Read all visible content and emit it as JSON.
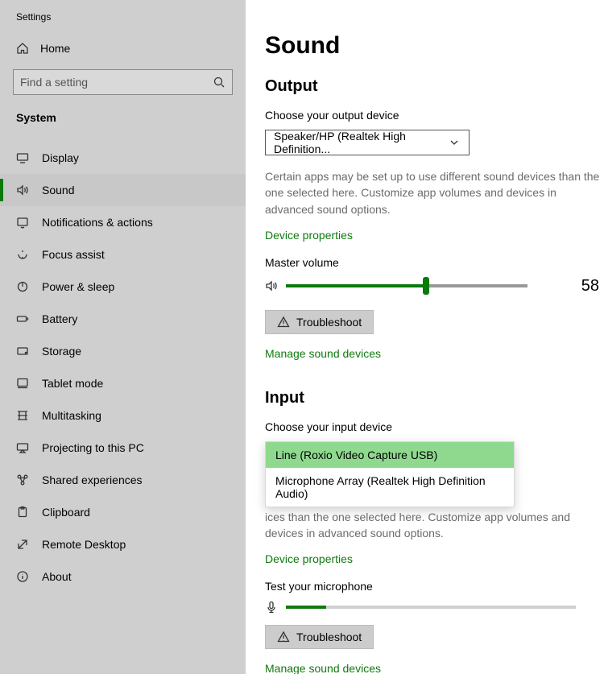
{
  "app_title": "Settings",
  "home_label": "Home",
  "search_placeholder": "Find a setting",
  "section_label": "System",
  "nav": [
    {
      "id": "display",
      "label": "Display"
    },
    {
      "id": "sound",
      "label": "Sound",
      "selected": true
    },
    {
      "id": "notifications",
      "label": "Notifications & actions"
    },
    {
      "id": "focus",
      "label": "Focus assist"
    },
    {
      "id": "power",
      "label": "Power & sleep"
    },
    {
      "id": "battery",
      "label": "Battery"
    },
    {
      "id": "storage",
      "label": "Storage"
    },
    {
      "id": "tablet",
      "label": "Tablet mode"
    },
    {
      "id": "multitask",
      "label": "Multitasking"
    },
    {
      "id": "projecting",
      "label": "Projecting to this PC"
    },
    {
      "id": "shared",
      "label": "Shared experiences"
    },
    {
      "id": "clipboard",
      "label": "Clipboard"
    },
    {
      "id": "remote",
      "label": "Remote Desktop"
    },
    {
      "id": "about",
      "label": "About"
    }
  ],
  "page": {
    "title": "Sound",
    "output": {
      "heading": "Output",
      "choose_label": "Choose your output device",
      "selected": "Speaker/HP (Realtek High Definition...",
      "description": "Certain apps may be set up to use different sound devices than the one selected here. Customize app volumes and devices in advanced sound options.",
      "device_props": "Device properties",
      "master_label": "Master volume",
      "volume": 58,
      "troubleshoot": "Troubleshoot",
      "manage": "Manage sound devices"
    },
    "input": {
      "heading": "Input",
      "choose_label": "Choose your input device",
      "options": [
        "Line (Roxio Video Capture USB)",
        "Microphone Array (Realtek High Definition Audio)"
      ],
      "selected_index": 0,
      "description_tail": "ices than the one selected here. Customize app volumes and devices in advanced sound options.",
      "device_props": "Device properties",
      "test_label": "Test your microphone",
      "level_pct": 14,
      "troubleshoot": "Troubleshoot",
      "manage": "Manage sound devices"
    }
  }
}
